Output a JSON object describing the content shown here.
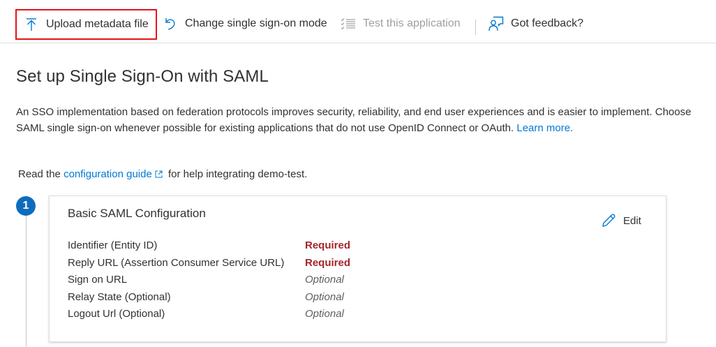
{
  "toolbar": {
    "upload_label": "Upload metadata file",
    "change_mode_label": "Change single sign-on mode",
    "test_label": "Test this application",
    "feedback_label": "Got feedback?",
    "highlight_color": "#e3141b"
  },
  "page": {
    "title": "Set up Single Sign-On with SAML",
    "description": "An SSO implementation based on federation protocols improves security, reliability, and end user experiences and is easier to implement. Choose SAML single sign-on whenever possible for existing applications that do not use OpenID Connect or OAuth.",
    "learn_more": "Learn more.",
    "guide_prefix": "Read the",
    "guide_link": "configuration guide",
    "guide_suffix": "for help integrating demo-test."
  },
  "step": {
    "number": "1",
    "card_title": "Basic SAML Configuration",
    "edit_label": "Edit",
    "fields": [
      {
        "label": "Identifier (Entity ID)",
        "value": "Required",
        "status": "required"
      },
      {
        "label": "Reply URL (Assertion Consumer Service URL)",
        "value": "Required",
        "status": "required"
      },
      {
        "label": "Sign on URL",
        "value": "Optional",
        "status": "optional"
      },
      {
        "label": "Relay State (Optional)",
        "value": "Optional",
        "status": "optional"
      },
      {
        "label": "Logout Url (Optional)",
        "value": "Optional",
        "status": "optional"
      }
    ]
  },
  "colors": {
    "accent": "#0078d4",
    "step_badge": "#0f6cbd",
    "required": "#a4262c"
  }
}
